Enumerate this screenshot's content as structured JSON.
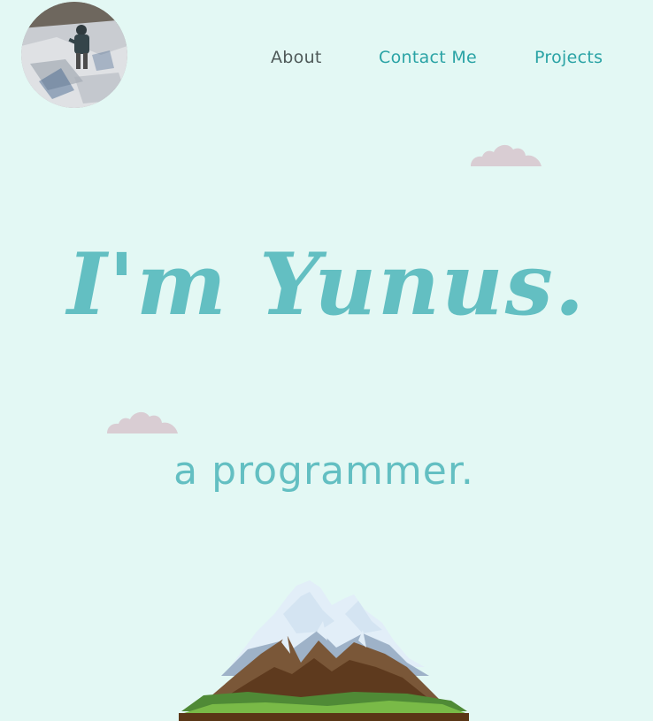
{
  "header": {
    "avatar_alt": "profile photo"
  },
  "nav": {
    "items": [
      {
        "label": "About",
        "color": "#4f5a59"
      },
      {
        "label": "Contact Me",
        "color": "#2aa3a5"
      },
      {
        "label": "Projects",
        "color": "#2aa3a5"
      }
    ]
  },
  "hero": {
    "title": "I'm Yunus.",
    "subtitle": "a programmer."
  },
  "colors": {
    "background": "#e3f8f4",
    "accent": "#63bfc2",
    "cloud": "#d9cdd3"
  },
  "decor": {
    "icons": [
      "cloud-icon",
      "cloud-icon",
      "mountain-illustration"
    ]
  }
}
